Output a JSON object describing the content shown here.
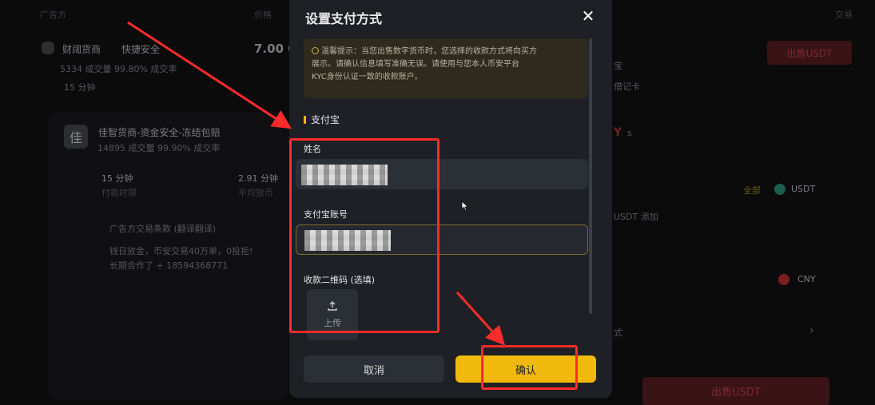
{
  "background": {
    "header_left": "广告方",
    "header_price": "价格",
    "header_right": "交易",
    "merchant1": {
      "avatar": "",
      "name": "财阔货商",
      "tag": "快捷安全",
      "stats": "5334 成交量   99.80% 成交率",
      "time": "15 分钟",
      "price": "7.00 C"
    },
    "merchant2": {
      "avatar": "佳",
      "name": "佳智货商-资金安全-冻结包赔",
      "stats": "14895 成交量   99.90% 成交率",
      "time_value": "15 分钟",
      "time_label": "付款时限",
      "avg_value": "2.91 分钟",
      "avg_label": "平均放币",
      "ad_terms_title": "广告方交易条款 (翻译翻译)",
      "ad_terms_line1": "钱日放金，币安交易40万单，0投拒!",
      "ad_terms_line2": "长期合作了 + 18594368771"
    },
    "right_col": {
      "sell_btn": "出售USDT",
      "snippet1": "宝",
      "snippet2": "借记卡",
      "y_text": "Y",
      "s_text": "s",
      "all_label": "全部",
      "coin_usdt": "USDT",
      "add_text": "USDT 添加",
      "coin_cny": "CNY",
      "way_text": "式",
      "chevron": "›",
      "bottom_sell": "出售USDT"
    }
  },
  "modal": {
    "title": "设置支付方式",
    "notice_line1": "温馨提示：当您出售数字货币时，您选择的收款方式将向买方",
    "notice_line2": "展示。请确认信息填写准确无误。请使用与您本人币安平台",
    "notice_line3": "KYC身份认证一致的收款账户。",
    "section_title": "支付宝",
    "name_label": "姓名",
    "account_label": "支付宝账号",
    "qr_label": "收款二维码 (选填)",
    "upload_label": "上传",
    "cancel_label": "取消",
    "confirm_label": "确认"
  },
  "colors": {
    "accent": "#f0b90b",
    "annotation": "#ff2b2b",
    "modal_bg": "#1e2026",
    "input_bg": "#2b2f36"
  }
}
